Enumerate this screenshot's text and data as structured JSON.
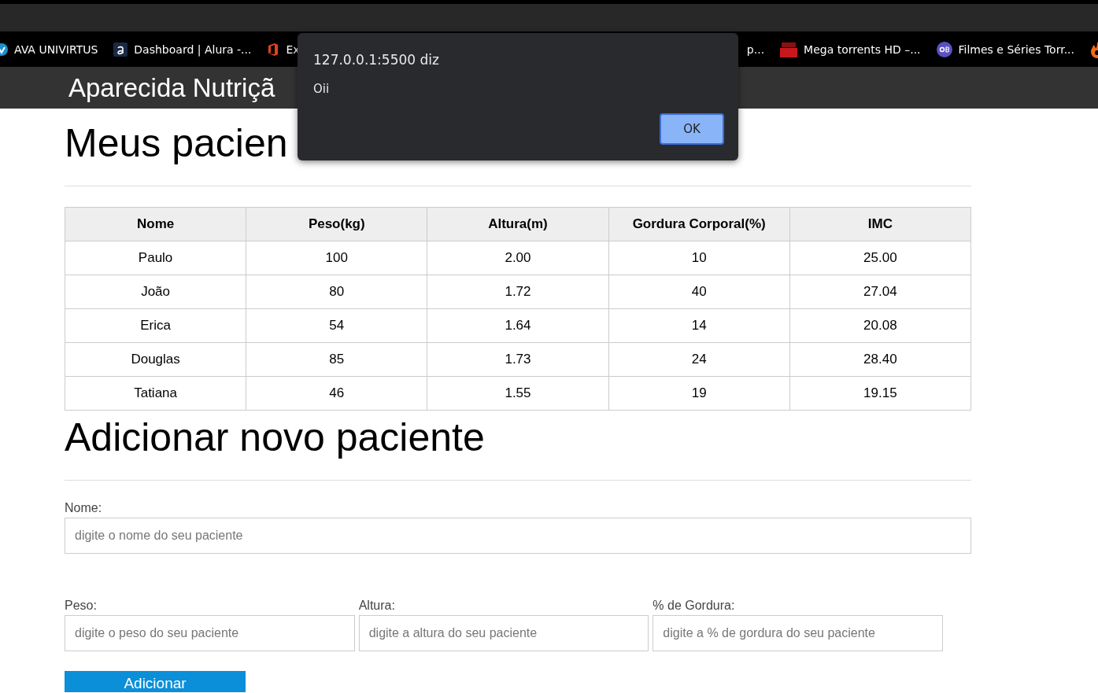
{
  "bookmarks_left": [
    {
      "label": "AVA UNIVIRTUS"
    },
    {
      "label": "Dashboard | Alura -..."
    },
    {
      "label": "Ex"
    }
  ],
  "bookmarks_right": [
    {
      "label": "p..."
    },
    {
      "label": "Mega torrents HD –..."
    },
    {
      "label": "Filmes e Séries Torr..."
    }
  ],
  "header": {
    "title": "Aparecida Nutriçã"
  },
  "patients_heading": "Meus pacien",
  "table": {
    "columns": [
      "Nome",
      "Peso(kg)",
      "Altura(m)",
      "Gordura Corporal(%)",
      "IMC"
    ],
    "rows": [
      [
        "Paulo",
        "100",
        "2.00",
        "10",
        "25.00"
      ],
      [
        "João",
        "80",
        "1.72",
        "40",
        "27.04"
      ],
      [
        "Erica",
        "54",
        "1.64",
        "14",
        "20.08"
      ],
      [
        "Douglas",
        "85",
        "1.73",
        "24",
        "28.40"
      ],
      [
        "Tatiana",
        "46",
        "1.55",
        "19",
        "19.15"
      ]
    ]
  },
  "form": {
    "heading": "Adicionar novo paciente",
    "name_field": {
      "label": "Nome:",
      "placeholder": "digite o nome do seu paciente"
    },
    "fields": [
      {
        "label": "Peso:",
        "placeholder": "digite o peso do seu paciente"
      },
      {
        "label": "Altura:",
        "placeholder": "digite a altura do seu paciente"
      },
      {
        "label": "% de Gordura:",
        "placeholder": "digite a % de gordura do seu paciente"
      }
    ],
    "submit": "Adicionar"
  },
  "dialog": {
    "title": "127.0.0.1:5500 diz",
    "message": "Oii",
    "button": "OK"
  }
}
